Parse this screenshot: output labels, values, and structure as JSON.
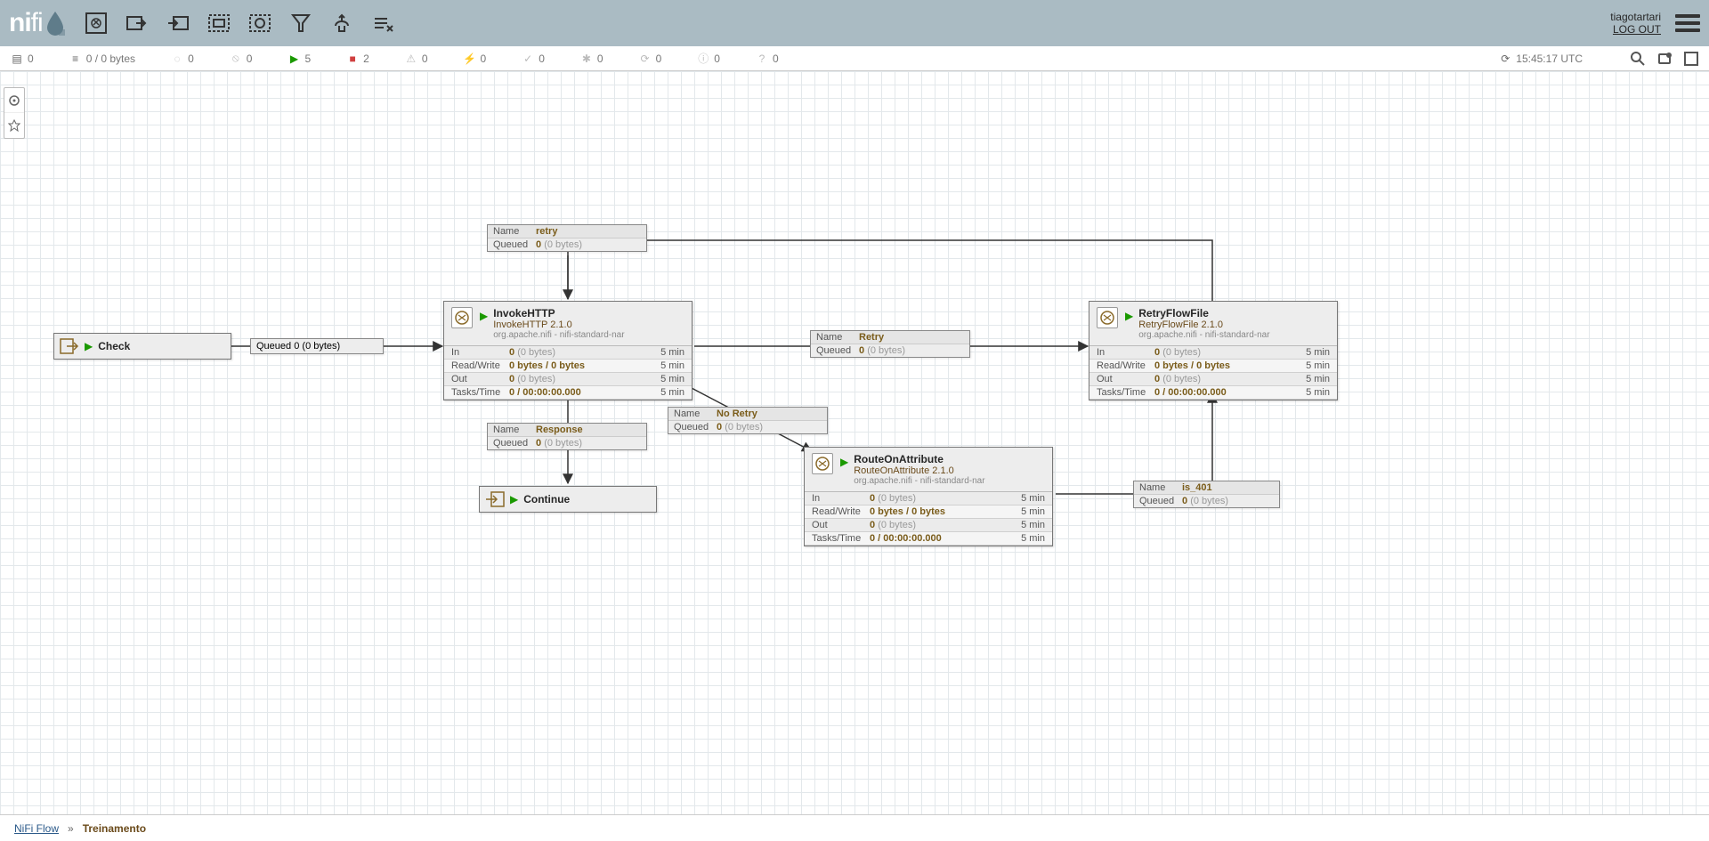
{
  "header": {
    "logo_text": "nifi",
    "username": "tiagotartari",
    "logout": "LOG OUT"
  },
  "statusbar": {
    "threads": "0",
    "queue": "0 / 0 bytes",
    "transmit_off": "0",
    "remote_off": "0",
    "running": "5",
    "stopped": "2",
    "invalid": "0",
    "disabled": "0",
    "uptodate": "0",
    "locally_mod": "0",
    "stale": "0",
    "sync_fail": "0",
    "unknown": "0",
    "time": "15:45:17 UTC"
  },
  "ports": {
    "check": {
      "name": "Check"
    },
    "continue": {
      "name": "Continue"
    }
  },
  "processors": {
    "invoke": {
      "title": "InvokeHTTP",
      "type": "InvokeHTTP 2.1.0",
      "bundle": "org.apache.nifi - nifi-standard-nar",
      "in_label": "In",
      "in_val": "0",
      "in_bytes": "(0 bytes)",
      "in_t": "5 min",
      "rw_label": "Read/Write",
      "rw_val": "0 bytes / 0 bytes",
      "rw_t": "5 min",
      "out_label": "Out",
      "out_val": "0",
      "out_bytes": "(0 bytes)",
      "out_t": "5 min",
      "tt_label": "Tasks/Time",
      "tt_val": "0 / 00:00:00.000",
      "tt_t": "5 min"
    },
    "route": {
      "title": "RouteOnAttribute",
      "type": "RouteOnAttribute 2.1.0",
      "bundle": "org.apache.nifi - nifi-standard-nar",
      "in_label": "In",
      "in_val": "0",
      "in_bytes": "(0 bytes)",
      "in_t": "5 min",
      "rw_label": "Read/Write",
      "rw_val": "0 bytes / 0 bytes",
      "rw_t": "5 min",
      "out_label": "Out",
      "out_val": "0",
      "out_bytes": "(0 bytes)",
      "out_t": "5 min",
      "tt_label": "Tasks/Time",
      "tt_val": "0 / 00:00:00.000",
      "tt_t": "5 min"
    },
    "retryff": {
      "title": "RetryFlowFile",
      "type": "RetryFlowFile 2.1.0",
      "bundle": "org.apache.nifi - nifi-standard-nar",
      "in_label": "In",
      "in_val": "0",
      "in_bytes": "(0 bytes)",
      "in_t": "5 min",
      "rw_label": "Read/Write",
      "rw_val": "0 bytes / 0 bytes",
      "rw_t": "5 min",
      "out_label": "Out",
      "out_val": "0",
      "out_bytes": "(0 bytes)",
      "out_t": "5 min",
      "tt_label": "Tasks/Time",
      "tt_val": "0 / 00:00:00.000",
      "tt_t": "5 min"
    }
  },
  "connections": {
    "check_invoke": {
      "qlabel": "Queued",
      "qval": "0",
      "qbytes": "(0 bytes)"
    },
    "retry_top": {
      "nlabel": "Name",
      "nval": "retry",
      "qlabel": "Queued",
      "qval": "0",
      "qbytes": "(0 bytes)"
    },
    "retry_side": {
      "nlabel": "Name",
      "nval": "Retry",
      "qlabel": "Queued",
      "qval": "0",
      "qbytes": "(0 bytes)"
    },
    "response": {
      "nlabel": "Name",
      "nval": "Response",
      "qlabel": "Queued",
      "qval": "0",
      "qbytes": "(0 bytes)"
    },
    "noretry": {
      "nlabel": "Name",
      "nval": "No Retry",
      "qlabel": "Queued",
      "qval": "0",
      "qbytes": "(0 bytes)"
    },
    "is401": {
      "nlabel": "Name",
      "nval": "is_401",
      "qlabel": "Queued",
      "qval": "0",
      "qbytes": "(0 bytes)"
    }
  },
  "breadcrumb": {
    "root": "NiFi Flow",
    "sep": "»",
    "current": "Treinamento"
  }
}
